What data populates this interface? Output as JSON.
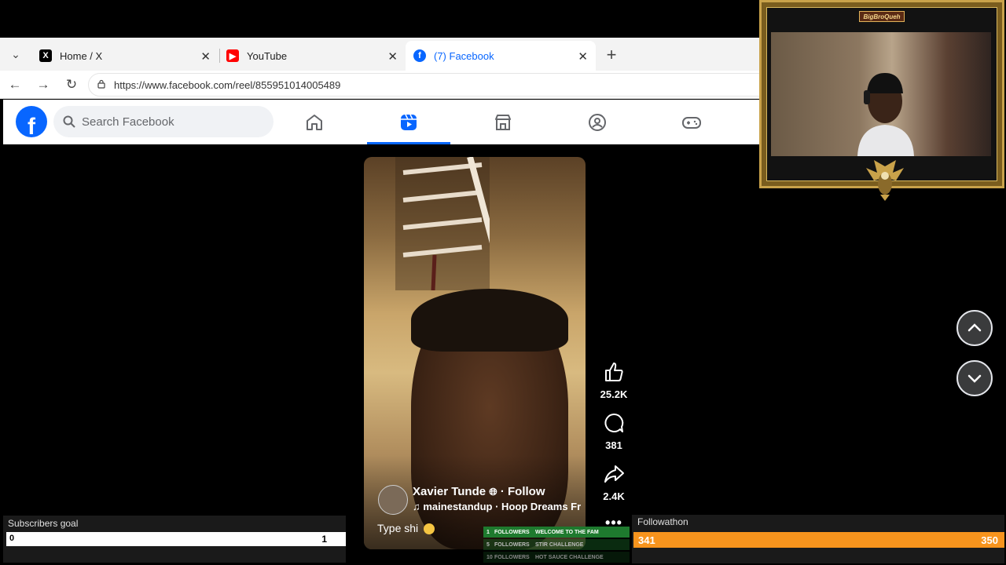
{
  "browser": {
    "tabs": [
      {
        "label": "Home / X",
        "icon": "x-logo-icon",
        "color": "#000000"
      },
      {
        "label": "YouTube",
        "icon": "youtube-logo-icon",
        "color": "#ff0000"
      },
      {
        "label": "(7) Facebook",
        "icon": "facebook-logo-icon",
        "color": "#0866ff",
        "active": true
      }
    ],
    "url": "https://www.facebook.com/reel/855951014005489"
  },
  "facebook": {
    "logo": "f",
    "search_placeholder": "Search Facebook",
    "nav": [
      {
        "name": "home",
        "icon": "home-icon"
      },
      {
        "name": "reels",
        "icon": "reels-icon",
        "active": true
      },
      {
        "name": "marketplace",
        "icon": "marketplace-icon"
      },
      {
        "name": "groups",
        "icon": "groups-icon"
      },
      {
        "name": "gaming",
        "icon": "gaming-icon"
      }
    ],
    "accent": "#0866ff"
  },
  "reel": {
    "author": "Xavier Tunde",
    "follow": "· Follow",
    "music": "mainestandup · Hoop Dreams Fr",
    "caption": "Type shi",
    "likes": "25.2K",
    "comments": "381",
    "shares": "2.4K"
  },
  "overlay": {
    "cam_label": "BigBroQueh",
    "subscribers_goal": {
      "title": "Subscribers goal",
      "current": "0",
      "target": "1"
    },
    "followathon": {
      "title": "Followathon",
      "current": "341",
      "target": "350",
      "color": "#f7941d"
    },
    "ticker": [
      {
        "num": "1",
        "col1": "FOLLOWERS",
        "col2": "WELCOME TO THE FAM"
      },
      {
        "num": "5",
        "col1": "FOLLOWERS",
        "col2": "STIR CHALLENGE"
      },
      {
        "num": "10",
        "col1": "FOLLOWERS",
        "col2": "HOT SAUCE CHALLENGE"
      }
    ]
  }
}
